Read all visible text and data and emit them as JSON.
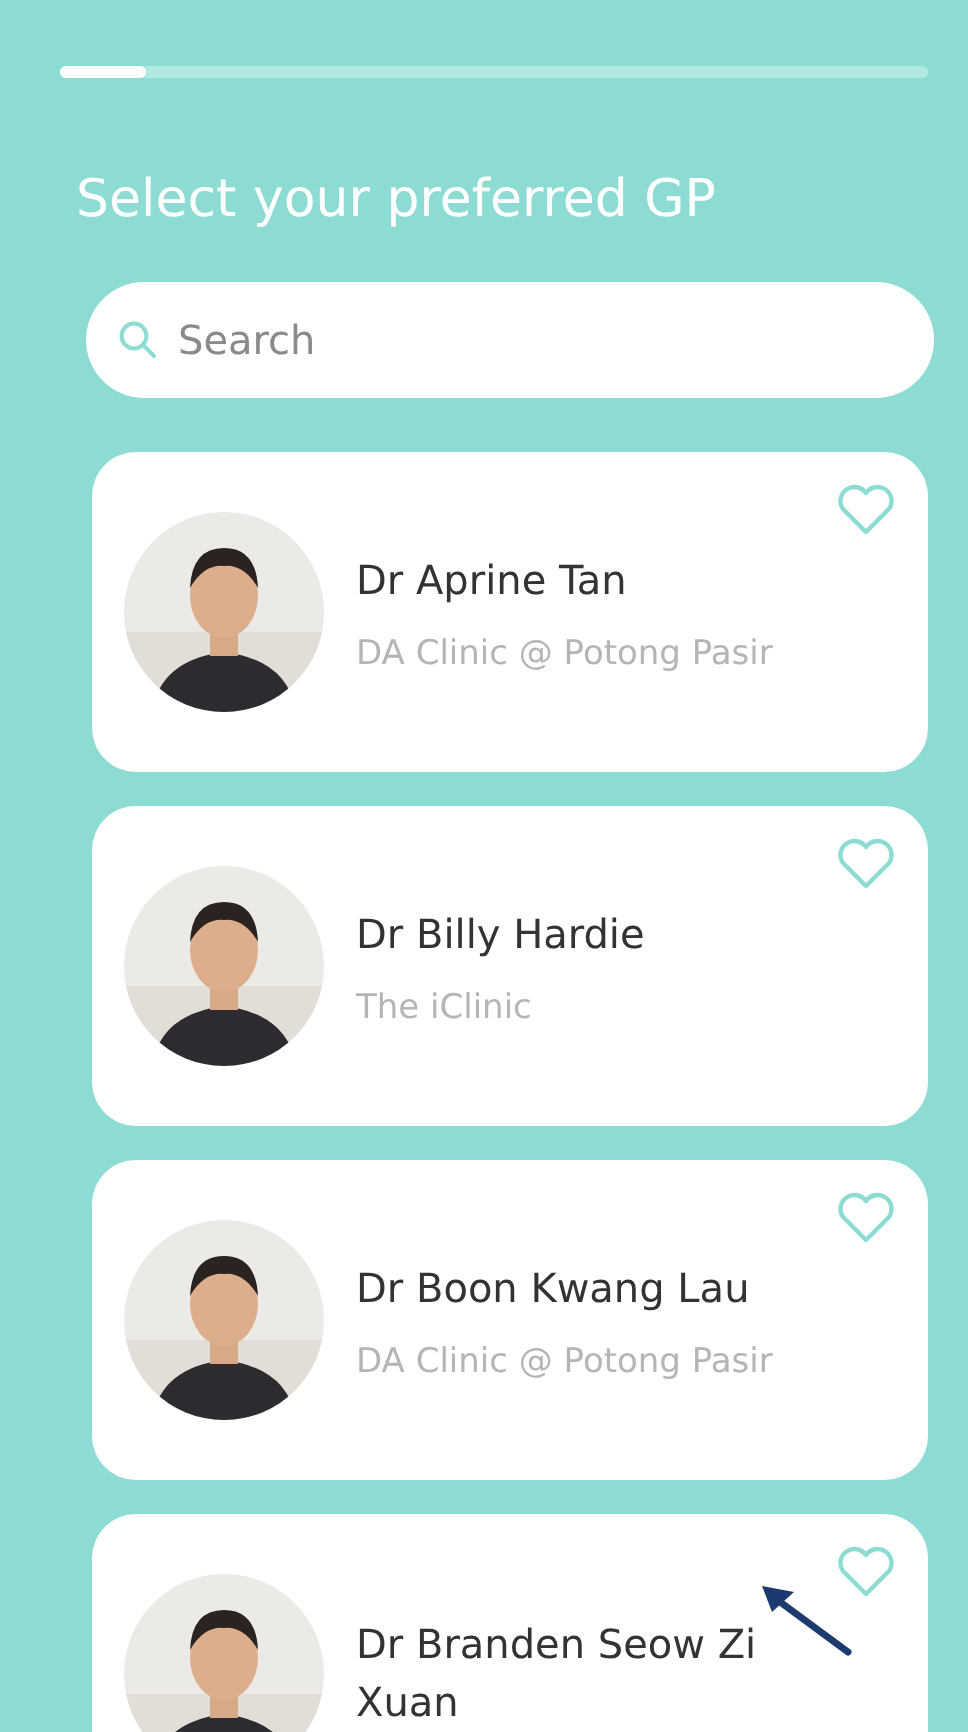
{
  "progress": {
    "level": 0.1
  },
  "title": "Select your preferred GP",
  "search": {
    "placeholder": "Search"
  },
  "doctors": [
    {
      "name": "Dr Aprine Tan",
      "clinic": "DA Clinic @ Potong Pasir",
      "favorite": false
    },
    {
      "name": "Dr Billy Hardie",
      "clinic": "The iClinic",
      "favorite": false
    },
    {
      "name": "Dr Boon Kwang Lau",
      "clinic": "DA Clinic @ Potong Pasir",
      "favorite": false
    },
    {
      "name": "Dr Branden Seow Zi Xuan",
      "favorite": false
    }
  ]
}
